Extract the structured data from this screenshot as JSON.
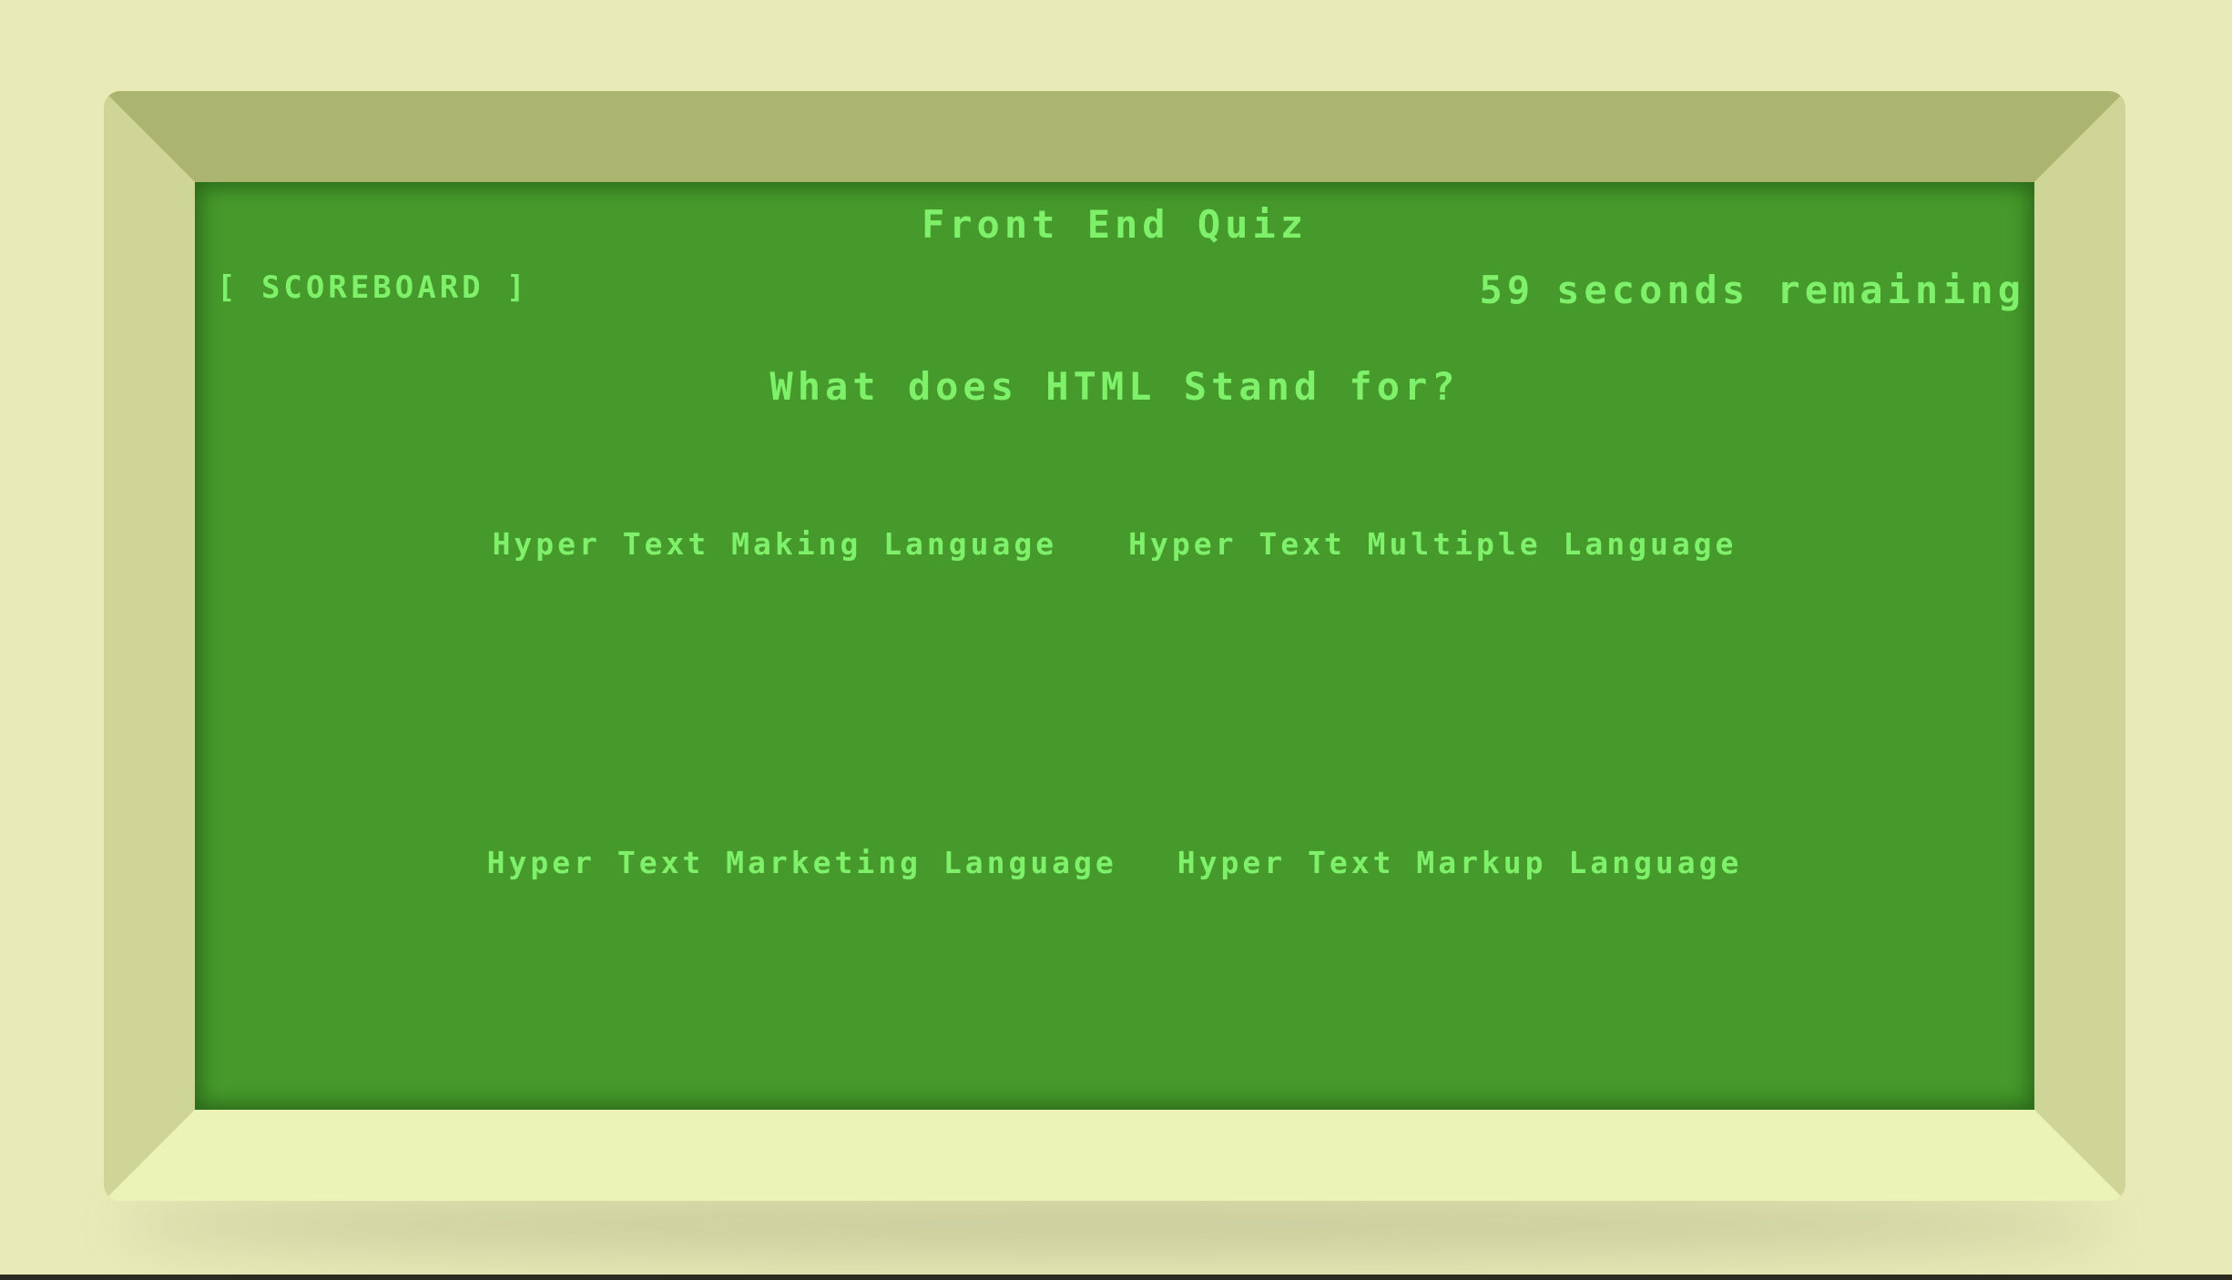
{
  "quiz": {
    "title": "Front End Quiz",
    "scoreboard_label": "[ SCOREBOARD ]",
    "timer": {
      "value": "59",
      "label": "seconds remaining"
    },
    "question": "What does HTML Stand for?",
    "choices": [
      "Hyper Text Making Language",
      "Hyper Text Multiple Language",
      "Hyper Text Marketing Language",
      "Hyper Text Markup Language"
    ]
  },
  "colors": {
    "page_background": "#e8eab8",
    "screen_background": "#469a2c",
    "screen_text": "#7ef06a",
    "bezel_top": "#acb56f",
    "bezel_sides": "#cfd497",
    "bezel_bottom": "#ecf3b7"
  }
}
